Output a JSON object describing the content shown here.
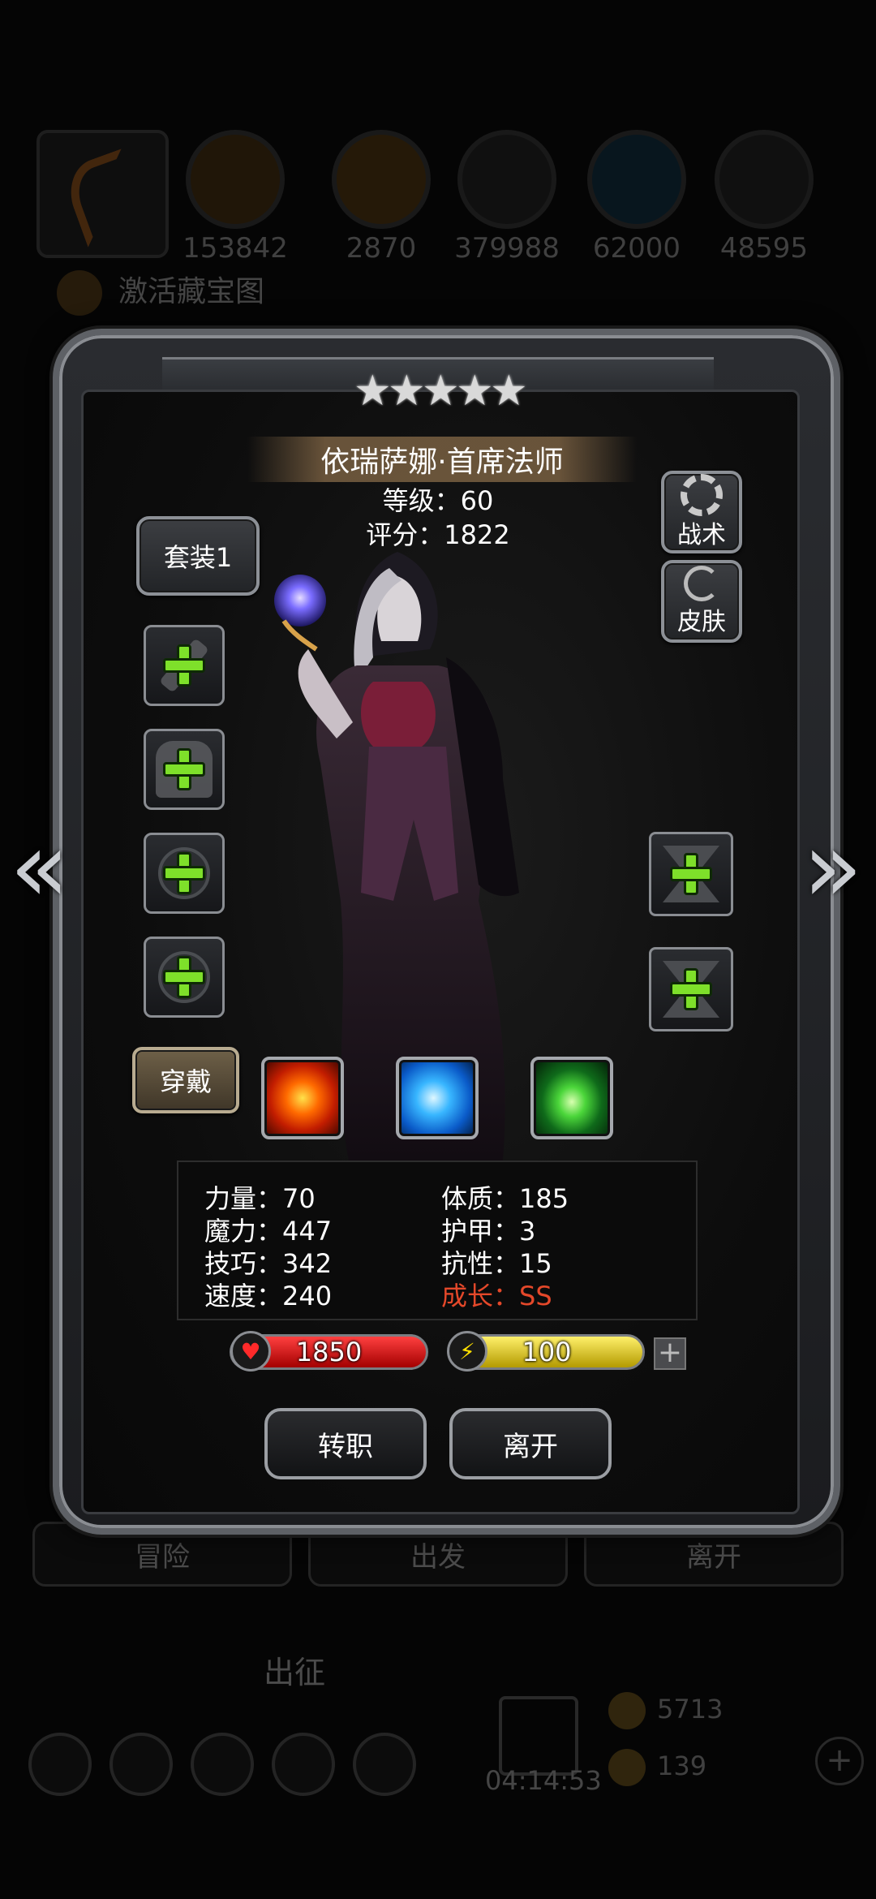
{
  "background": {
    "resources": [
      "153842",
      "2870",
      "379988",
      "62000",
      "48595"
    ],
    "tip": "激活藏宝图",
    "tabs": [
      "冒险",
      "出发",
      "离开"
    ],
    "expedition": "出征",
    "timer": "04:14:53",
    "coins": "5713",
    "gems": "139"
  },
  "hero": {
    "stars": 5,
    "name": "依瑞萨娜·首席法师",
    "level_label": "等级：60",
    "score_label": "评分：1822"
  },
  "buttons": {
    "set": "套装1",
    "tactics": "战术",
    "skin": "皮肤",
    "wear": "穿戴",
    "promote": "转职",
    "leave": "离开"
  },
  "stats": {
    "strength": "力量：70",
    "magic": "魔力：447",
    "skill": "技巧：342",
    "speed": "速度：240",
    "constitution": "体质：185",
    "armor": "护甲：3",
    "resistance": "抗性：15",
    "growth": "成长：SS"
  },
  "bars": {
    "hp": "1850",
    "energy": "100"
  },
  "icons": {
    "left_arrow": "«",
    "right_arrow": "»",
    "heart": "♥",
    "bolt": "⚡",
    "add": "+"
  },
  "colors": {
    "growth": "#e4482a",
    "plus_green": "#7ee02a",
    "hp_red": "#d00000",
    "energy_yellow": "#e6d000"
  }
}
